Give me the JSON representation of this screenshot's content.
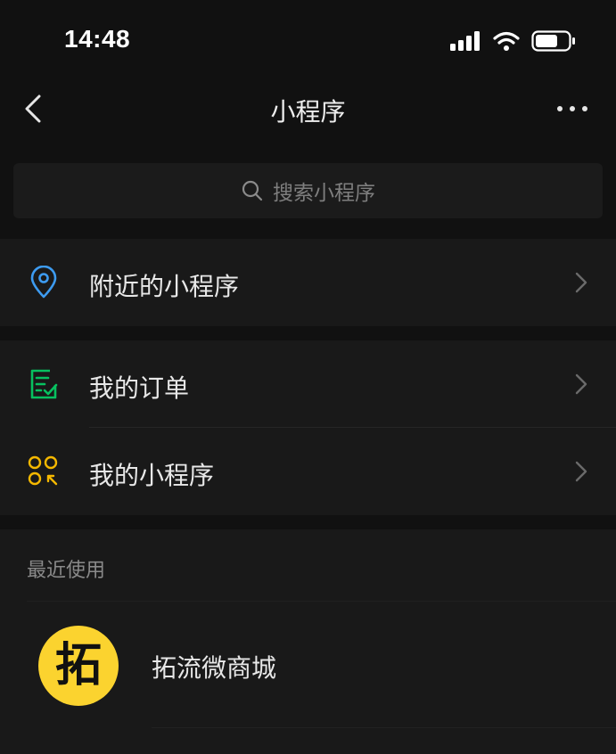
{
  "status_bar": {
    "time": "14:48",
    "signal_icon": "cellular-signal-icon",
    "wifi_icon": "wifi-icon",
    "battery_icon": "battery-icon"
  },
  "nav": {
    "title": "小程序",
    "back_icon": "chevron-left-icon",
    "more_icon": "more-horizontal-icon"
  },
  "search": {
    "placeholder": "搜索小程序",
    "icon": "search-icon"
  },
  "menu": {
    "nearby": {
      "label": "附近的小程序",
      "icon": "location-pin-icon",
      "icon_color": "#3d9bf0"
    },
    "orders": {
      "label": "我的订单",
      "icon": "order-list-icon",
      "icon_color": "#07c160"
    },
    "my_apps": {
      "label": "我的小程序",
      "icon": "mini-programs-icon",
      "icon_color": "#f5b800"
    }
  },
  "recent": {
    "section_title": "最近使用",
    "items": [
      {
        "name": "拓流微商城",
        "logo_text": "拓",
        "logo_color": "#fbd32f"
      }
    ]
  },
  "colors": {
    "background": "#111111",
    "card": "#191919",
    "text": "#e8e8e8",
    "muted": "#8a8a8a"
  }
}
